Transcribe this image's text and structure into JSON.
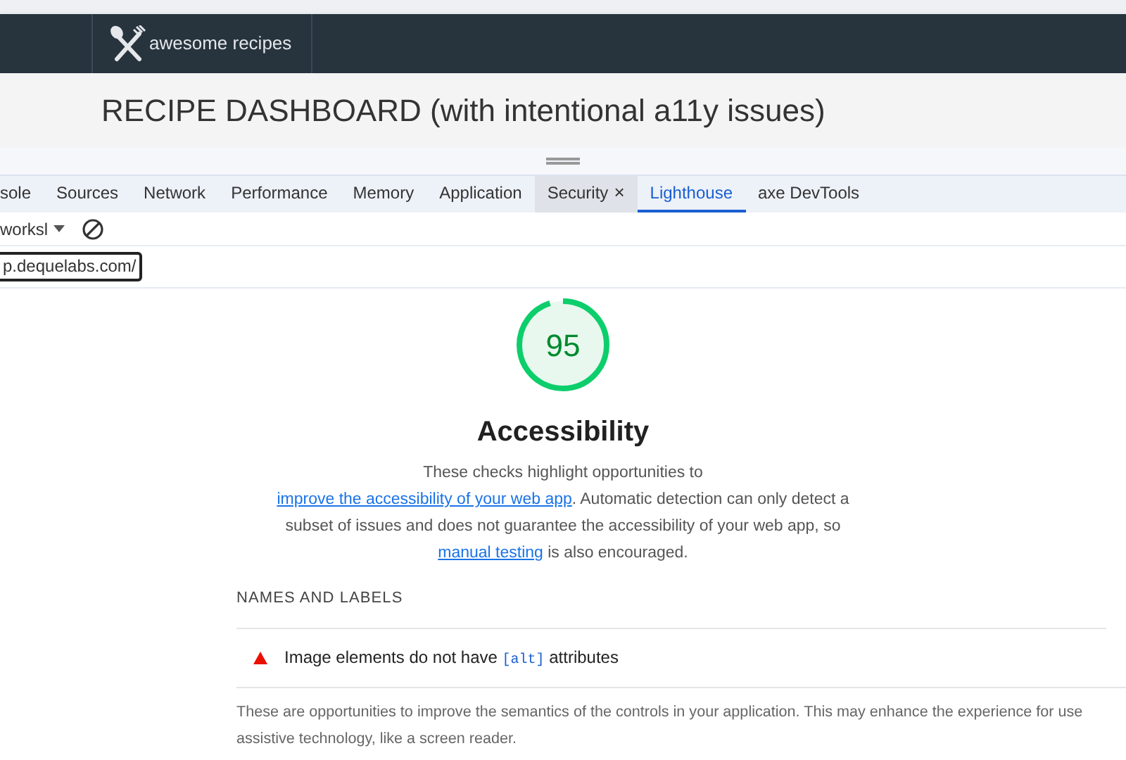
{
  "navbar": {
    "brand": "awesome recipes"
  },
  "page_title": "RECIPE DASHBOARD (with intentional a11y issues)",
  "devtools": {
    "tabs": [
      {
        "label": "sole",
        "selected": false,
        "closable": false
      },
      {
        "label": "Sources",
        "selected": false,
        "closable": false
      },
      {
        "label": "Network",
        "selected": false,
        "closable": false
      },
      {
        "label": "Performance",
        "selected": false,
        "closable": false
      },
      {
        "label": "Memory",
        "selected": false,
        "closable": false
      },
      {
        "label": "Application",
        "selected": false,
        "closable": false
      },
      {
        "label": "Security",
        "selected": false,
        "closable": true,
        "close": "×"
      },
      {
        "label": "Lighthouse",
        "selected": true,
        "closable": false
      },
      {
        "label": "axe DevTools",
        "selected": false,
        "closable": false
      }
    ],
    "toolbar": {
      "dropdown": "worksl"
    },
    "url": "p.dequelabs.com/"
  },
  "report": {
    "score": "95",
    "level": 0.95,
    "category": "Accessibility",
    "description": [
      {
        "kind": "text",
        "text": "These checks highlight opportunities to "
      },
      {
        "kind": "link",
        "text": "improve the accessibility of your web app"
      },
      {
        "kind": "text",
        "text": ". Automatic detection can only detect a subset of issues and does not guarantee the accessibility of your web app, so "
      },
      {
        "kind": "link",
        "text": "manual testing"
      },
      {
        "kind": "text",
        "text": " is also encouraged."
      }
    ],
    "group_title": "NAMES AND LABELS",
    "audits": [
      {
        "kind": "fail",
        "parts": [
          {
            "kind": "text",
            "text": "Image elements do not have "
          },
          {
            "kind": "code",
            "text": "[alt]"
          },
          {
            "kind": "text",
            "text": " attributes"
          }
        ]
      }
    ],
    "group_description_lines": [
      "These are opportunities to improve the semantics of the controls in your application. This may enhance the experience for use",
      "assistive technology, like a screen reader."
    ]
  }
}
